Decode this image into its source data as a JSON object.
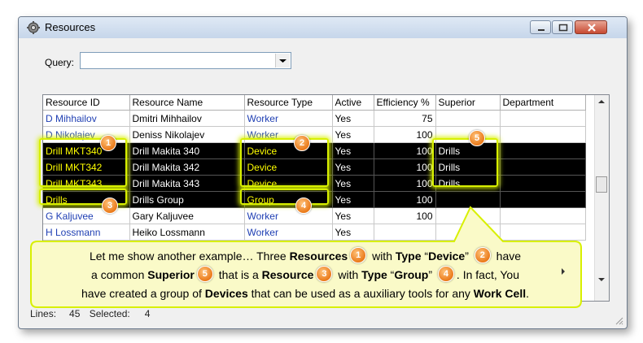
{
  "window": {
    "title": "Resources"
  },
  "query": {
    "label": "Query:",
    "value": ""
  },
  "table": {
    "columns": [
      "Resource ID",
      "Resource Name",
      "Resource Type",
      "Active",
      "Efficiency %",
      "Superior",
      "Department"
    ],
    "rows": [
      {
        "id": "D Mihhailov",
        "name": "Dmitri Mihhailov",
        "type": "Worker",
        "active": "Yes",
        "efficiency": "75",
        "superior": "",
        "department": "",
        "selected": false
      },
      {
        "id": "D Nikolajev",
        "name": "Deniss Nikolajev",
        "type": "Worker",
        "active": "Yes",
        "efficiency": "100",
        "superior": "",
        "department": "",
        "selected": false
      },
      {
        "id": "Drill MKT340",
        "name": "Drill Makita 340",
        "type": "Device",
        "active": "Yes",
        "efficiency": "100",
        "superior": "Drills",
        "department": "",
        "selected": true
      },
      {
        "id": "Drill MKT342",
        "name": "Drill Makita 342",
        "type": "Device",
        "active": "Yes",
        "efficiency": "100",
        "superior": "Drills",
        "department": "",
        "selected": true
      },
      {
        "id": "Drill MKT343",
        "name": "Drill Makita 343",
        "type": "Device",
        "active": "Yes",
        "efficiency": "100",
        "superior": "Drills",
        "department": "",
        "selected": true
      },
      {
        "id": "Drills",
        "name": "Drills Group",
        "type": "Group",
        "active": "Yes",
        "efficiency": "100",
        "superior": "",
        "department": "",
        "selected": true
      },
      {
        "id": "G Kaljuvee",
        "name": "Gary Kaljuvee",
        "type": "Worker",
        "active": "Yes",
        "efficiency": "100",
        "superior": "",
        "department": "",
        "selected": false
      },
      {
        "id": "H Lossmann",
        "name": "Heiko Lossmann",
        "type": "Worker",
        "active": "Yes",
        "efficiency": "",
        "superior": "",
        "department": "",
        "selected": false
      }
    ]
  },
  "status": {
    "lines_label": "Lines:",
    "lines_value": "45",
    "selected_label": "Selected:",
    "selected_value": "4"
  },
  "badges": [
    "1",
    "2",
    "3",
    "4",
    "5"
  ],
  "callout": {
    "p1": "Let me show another example… Three ",
    "resources": "Resources",
    "p2": " with ",
    "type1": "Type",
    "p3": " “",
    "device": "Device",
    "p4": "” ",
    "p5": " have",
    "p6": "a common ",
    "superior": "Superior",
    "p7": " that is a ",
    "resource": "Resource",
    "p8": " with ",
    "type2": "Type",
    "p9": " “",
    "group": "Group",
    "p10": "” ",
    "p11": ". In fact, You",
    "p12": "have created a group of ",
    "devices": "Devices",
    "p13": " that can be used as a auxiliary tools for any ",
    "workcell": "Work Cell",
    "p14": "."
  },
  "colors": {
    "highlight": "#d8f000",
    "badge": "#ea7a1a",
    "callout_bg": "#fafac8",
    "link_blue": "#1f3fb3"
  }
}
